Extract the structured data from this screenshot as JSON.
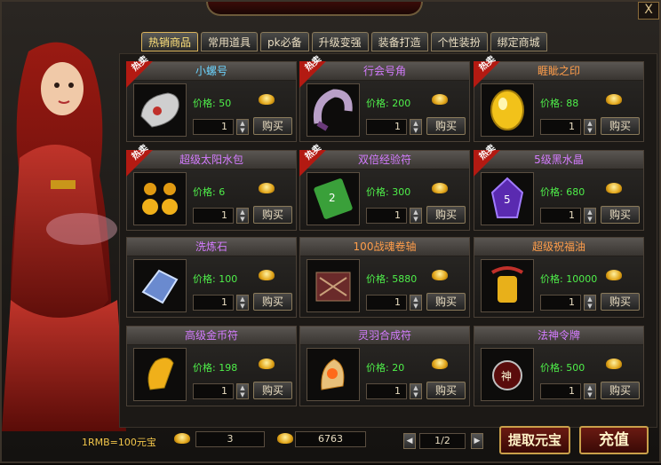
{
  "window": {
    "close_label": "X"
  },
  "tabs": [
    {
      "label": "热销商品",
      "active": true
    },
    {
      "label": "常用道具",
      "active": false
    },
    {
      "label": "pk必备",
      "active": false
    },
    {
      "label": "升级变强",
      "active": false
    },
    {
      "label": "装备打造",
      "active": false
    },
    {
      "label": "个性装扮",
      "active": false
    },
    {
      "label": "绑定商城",
      "active": false
    }
  ],
  "items": [
    {
      "name": "小螺号",
      "price": "价格: 50",
      "qty": "1",
      "buy": "购买",
      "hot": "热卖",
      "color": "cyan"
    },
    {
      "name": "行会号角",
      "price": "价格: 200",
      "qty": "1",
      "buy": "购买",
      "hot": "热卖",
      "color": "purple"
    },
    {
      "name": "睚眦之印",
      "price": "价格: 88",
      "qty": "1",
      "buy": "购买",
      "hot": "热卖",
      "color": "orange"
    },
    {
      "name": "超级太阳水包",
      "price": "价格: 6",
      "qty": "1",
      "buy": "购买",
      "hot": "热卖",
      "color": "purple"
    },
    {
      "name": "双倍经验符",
      "price": "价格: 300",
      "qty": "1",
      "buy": "购买",
      "hot": "热卖",
      "color": "purple"
    },
    {
      "name": "5级黑水晶",
      "price": "价格: 680",
      "qty": "1",
      "buy": "购买",
      "hot": "热卖",
      "color": "purple"
    },
    {
      "name": "洗炼石",
      "price": "价格: 100",
      "qty": "1",
      "buy": "购买",
      "hot": "",
      "color": "purple"
    },
    {
      "name": "100战魂卷轴",
      "price": "价格: 5880",
      "qty": "1",
      "buy": "购买",
      "hot": "",
      "color": "orange"
    },
    {
      "name": "超级祝福油",
      "price": "价格: 10000",
      "qty": "1",
      "buy": "购买",
      "hot": "",
      "color": "orange"
    },
    {
      "name": "高级金币符",
      "price": "价格: 198",
      "qty": "1",
      "buy": "购买",
      "hot": "",
      "color": "purple"
    },
    {
      "name": "灵羽合成符",
      "price": "价格: 20",
      "qty": "1",
      "buy": "购买",
      "hot": "",
      "color": "purple"
    },
    {
      "name": "法神令牌",
      "price": "价格: 500",
      "qty": "1",
      "buy": "购买",
      "hot": "",
      "color": "purple"
    }
  ],
  "footer": {
    "rate": "1RMB=100元宝",
    "yuanbao": "3",
    "bound_yuanbao": "6763",
    "page": "1/2",
    "withdraw": "提取元宝",
    "recharge": "充值"
  },
  "colors": {
    "orange": "#ff9d4a",
    "purple": "#d47cff",
    "cyan": "#6cd4ff",
    "price": "#4ff04a"
  }
}
